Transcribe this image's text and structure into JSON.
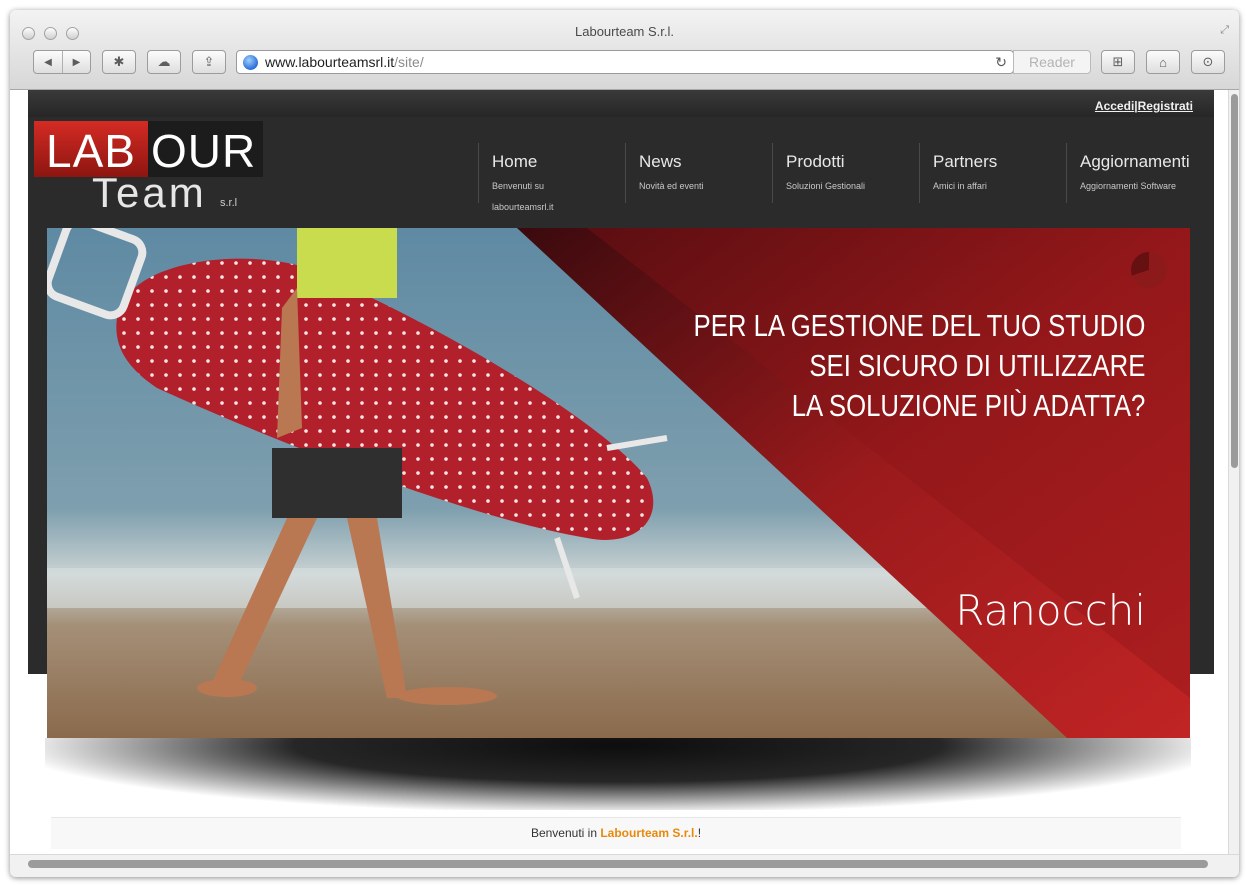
{
  "browser": {
    "window_title": "Labourteam S.r.l.",
    "url_host": "www.labourteamsrl.it",
    "url_path": "/site/",
    "reader_label": "Reader"
  },
  "site": {
    "auth": {
      "login": "Accedi",
      "separator": "|",
      "register": "Registrati"
    },
    "logo": {
      "part1": "LAB",
      "part2": "OUR",
      "part3": "Team",
      "suffix": "s.r.l"
    },
    "nav": [
      {
        "label": "Home",
        "sub": "Benvenuti su labourteamsrl.it"
      },
      {
        "label": "News",
        "sub": "Novità ed eventi"
      },
      {
        "label": "Prodotti",
        "sub": "Soluzioni Gestionali"
      },
      {
        "label": "Partners",
        "sub": "Amici in affari"
      },
      {
        "label": "Aggiornamenti",
        "sub": "Aggiornamenti Software"
      }
    ],
    "banner": {
      "line1": "PER LA GESTIONE DEL TUO STUDIO",
      "line2": "SEI SICURO DI UTILIZZARE",
      "line3": "LA SOLUZIONE PIÙ ADATTA?",
      "brand": "Ranocchi"
    },
    "welcome": {
      "prefix": "Benvenuti in ",
      "brand": "Labourteam S.r.l.",
      "suffix": "!"
    }
  },
  "colors": {
    "accent_red": "#b11f1f",
    "brand_orange": "#e8890c",
    "header_dark": "#2b2b2b"
  }
}
